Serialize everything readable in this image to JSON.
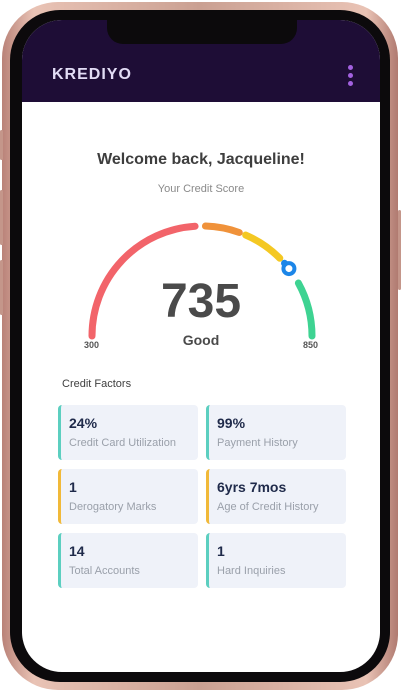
{
  "app": {
    "brand": "KREDIYO",
    "menu_icon": "kebab-menu-icon"
  },
  "welcome": "Welcome back, Jacqueline!",
  "subtitle": "Your Credit Score",
  "score": {
    "value": "735",
    "rating": "Good",
    "min": "300",
    "max": "850",
    "fraction": 0.79
  },
  "gauge_segments": [
    {
      "name": "red",
      "color": "#f2646a",
      "from": 0,
      "to": 0.48
    },
    {
      "name": "orange",
      "color": "#f0923a",
      "from": 0.51,
      "to": 0.61
    },
    {
      "name": "yellow",
      "color": "#f4c823",
      "from": 0.63,
      "to": 0.75
    },
    {
      "name": "blue",
      "color": "#1c86e8",
      "from": 0.77,
      "to": 0.8
    },
    {
      "name": "green",
      "color": "#3ed392",
      "from": 0.84,
      "to": 1.0
    }
  ],
  "credit_factors": {
    "title": "Credit Factors",
    "items": [
      {
        "value": "24%",
        "label": "Credit Card Utilization",
        "status": "good"
      },
      {
        "value": "99%",
        "label": "Payment History",
        "status": "good"
      },
      {
        "value": "1",
        "label": "Derogatory Marks",
        "status": "warn"
      },
      {
        "value": "6yrs 7mos",
        "label": "Age of Credit History",
        "status": "warn"
      },
      {
        "value": "14",
        "label": "Total Accounts",
        "status": "good"
      },
      {
        "value": "1",
        "label": "Hard Inquiries",
        "status": "good"
      }
    ]
  }
}
